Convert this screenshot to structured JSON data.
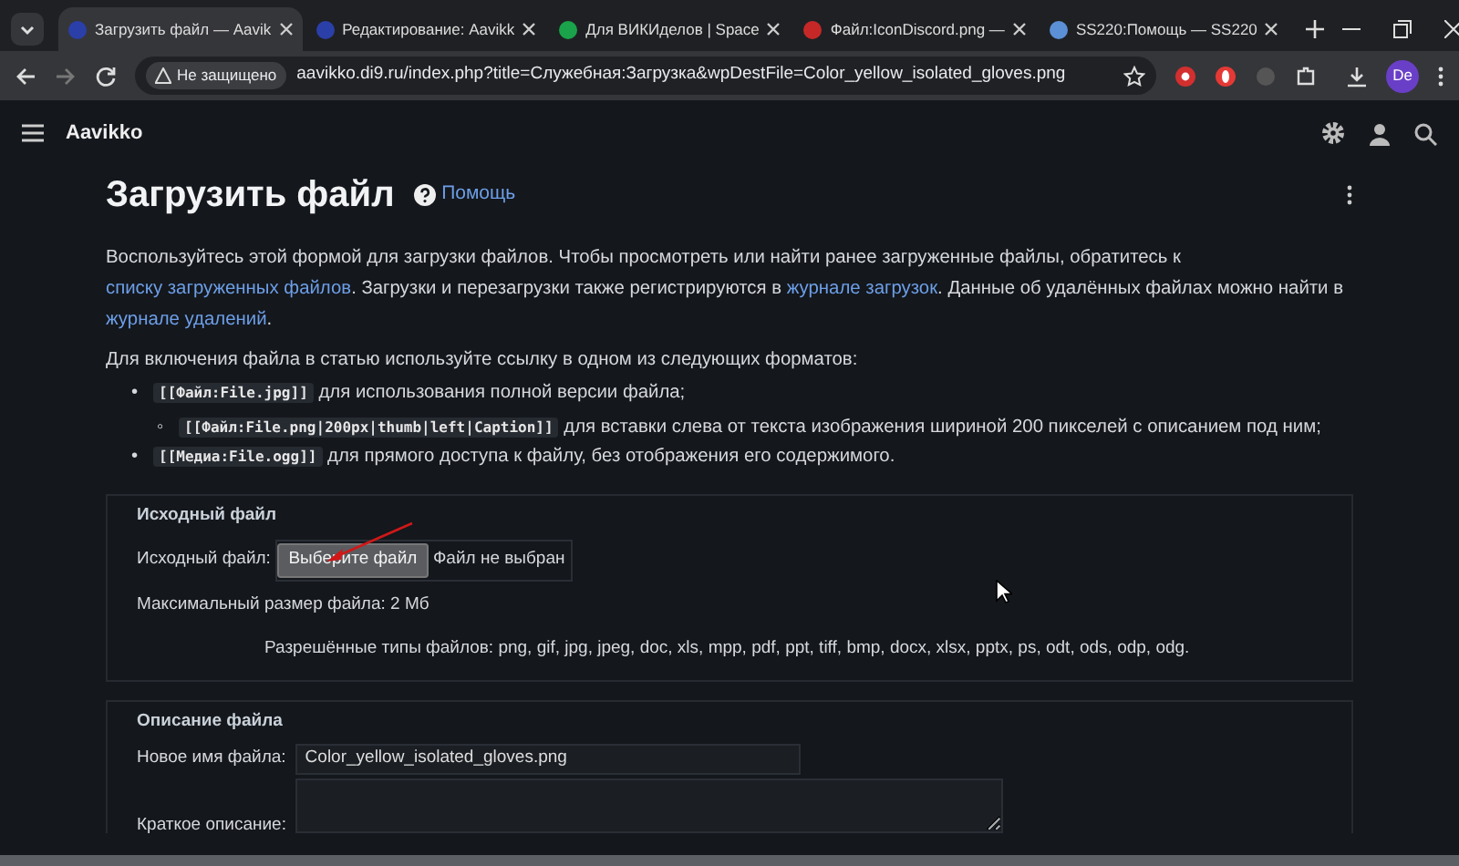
{
  "browser": {
    "tabs": [
      {
        "title": "Загрузить файл — Aavik",
        "selected": true
      },
      {
        "title": "Редактирование: Aavikk",
        "selected": false
      },
      {
        "title": "Для ВИКИделов | Space",
        "selected": false
      },
      {
        "title": "Файл:IconDiscord.png —",
        "selected": false
      },
      {
        "title": "SS220:Помощь — SS220",
        "selected": false
      }
    ],
    "security": "Не защищено",
    "url": "aavikko.di9.ru/index.php?title=Служебная:Загрузка&wpDestFile=Color_yellow_isolated_gloves.png",
    "profile": "De"
  },
  "site": {
    "name": "Aavikko"
  },
  "page": {
    "title": "Загрузить файл",
    "help": "Помощь",
    "intro": [
      {
        "text": "Воспользуйтесь этой формой для загрузки файлов. Чтобы просмотреть или найти ранее загруженные файлы, обратитесь к",
        "kind": "text"
      },
      {
        "text": "списку загруженных файлов",
        "kind": "link"
      },
      {
        "text": ". Загрузки и перезагрузки также регистрируются в",
        "kind": "text"
      },
      {
        "text": "журнале загрузок",
        "kind": "link"
      },
      {
        "text": ". Данные об удалённых файлах можно найти в",
        "kind": "text"
      },
      {
        "text": "журнале удалений",
        "kind": "link"
      },
      {
        "text": ".",
        "kind": "text"
      }
    ],
    "formats_intro": "Для включения файла в статью используйте ссылку в одном из следующих форматов:",
    "formats": [
      {
        "marker": "•",
        "code": "[[Файл:File.jpg]]",
        "text": "для использования полной версии файла;",
        "children": [
          {
            "marker": "◦",
            "code": "[[Файл:File.png|200px|thumb|left|Caption]]",
            "text": "для вставки слева от текста изображения шириной 200 пикселей с описанием под ним;"
          }
        ]
      },
      {
        "marker": "•",
        "code": "[[Медиа:File.ogg]]",
        "text": "для прямого доступа к файлу, без отображения его содержимого."
      }
    ]
  },
  "source": {
    "legend": "Исходный файл",
    "label": "Исходный файл:",
    "button": "Выберите файл",
    "no_file": "Файл не выбран",
    "max_size": "Максимальный размер файла: 2 Мб",
    "allowed": "Разрешённые типы файлов: png, gif, jpg, jpeg, doc, xls, mpp, pdf, ppt, tiff, bmp, docx, xlsx, pptx, ps, odt, ods, odp, odg."
  },
  "description": {
    "legend": "Описание файла",
    "name_label": "Новое имя файла:",
    "name_value": "Color_yellow_isolated_gloves.png",
    "summary_label": "Краткое описание:"
  }
}
